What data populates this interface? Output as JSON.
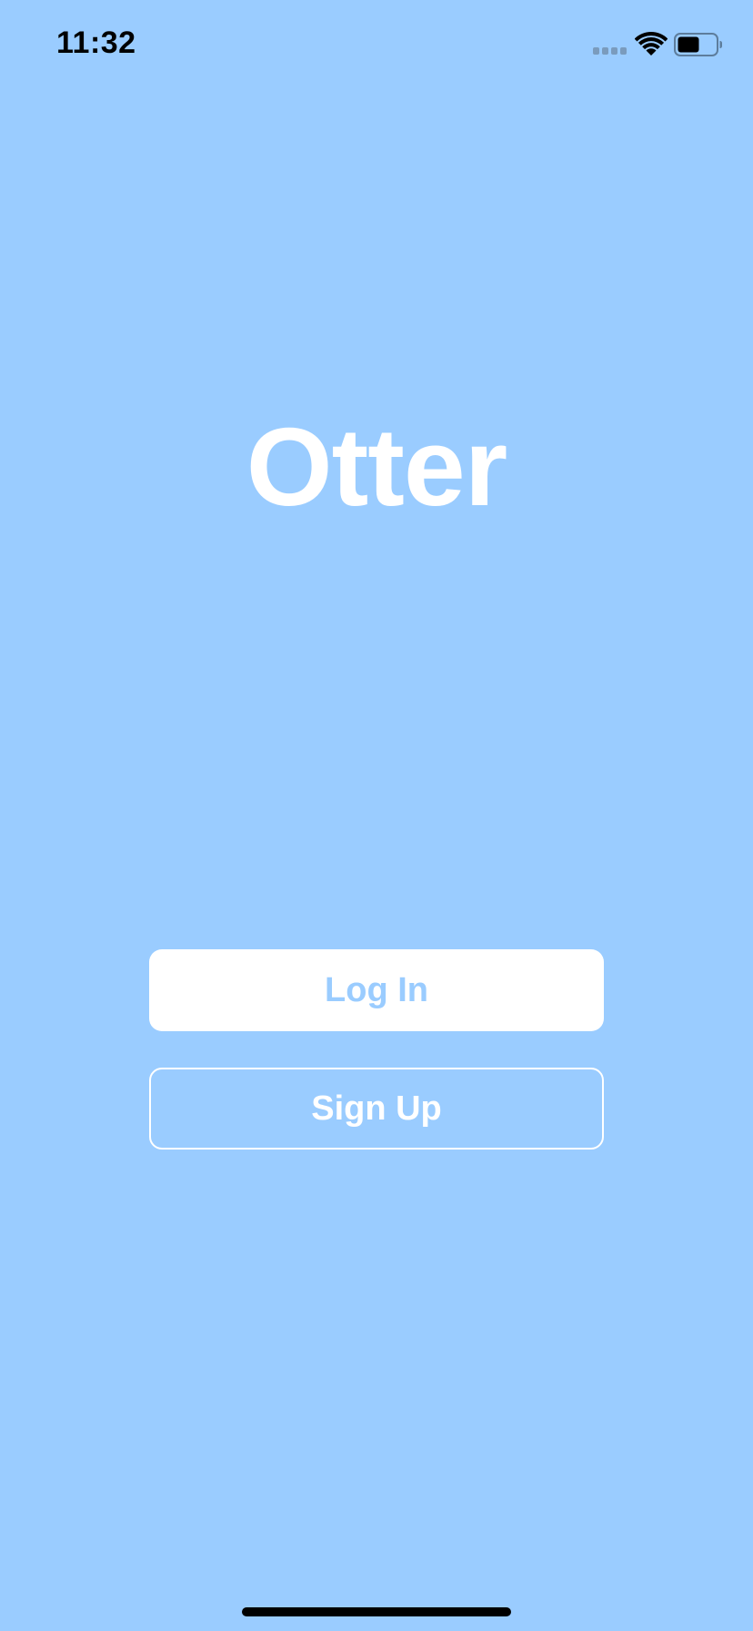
{
  "status_bar": {
    "time": "11:32",
    "icons": [
      "cellular-signal-icon",
      "wifi-icon",
      "battery-icon"
    ]
  },
  "app": {
    "title": "Otter"
  },
  "buttons": {
    "login_label": "Log In",
    "signup_label": "Sign Up"
  },
  "colors": {
    "background": "#9ACCFF",
    "button_fill": "#FFFFFF",
    "login_text": "#9ACCFF",
    "signup_text": "#FFFFFF"
  }
}
